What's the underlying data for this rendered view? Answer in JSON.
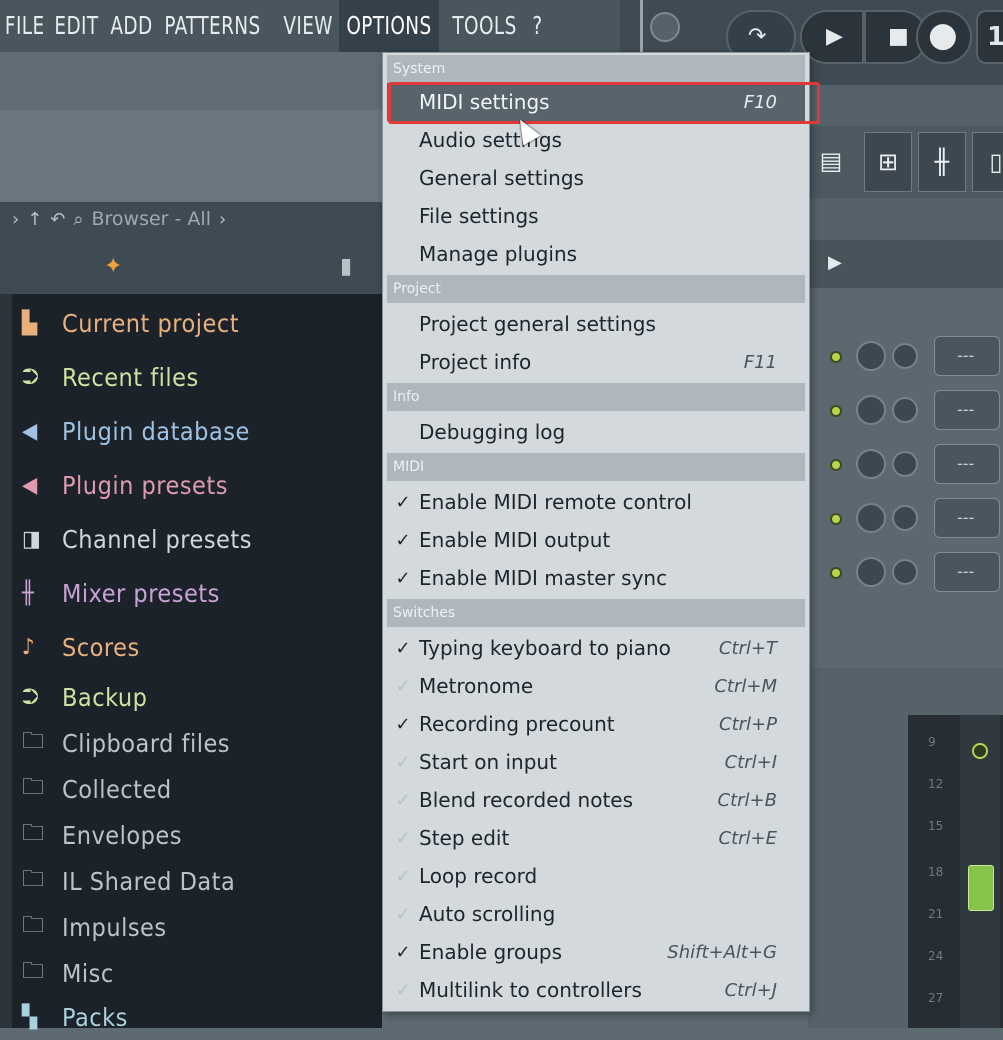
{
  "menubar": {
    "items": [
      "FILE",
      "EDIT",
      "ADD",
      "PATTERNS",
      "VIEW",
      "OPTIONS",
      "TOOLS",
      "?"
    ],
    "active": "OPTIONS"
  },
  "transport": {
    "counter_digit": "1"
  },
  "browser": {
    "header": "Browser - All",
    "items": [
      {
        "label": "Current project",
        "icon": "folder-doc-icon",
        "color": "#e8b07c"
      },
      {
        "label": "Recent files",
        "icon": "recent-files-icon",
        "color": "#cfe2a2"
      },
      {
        "label": "Plugin database",
        "icon": "plugin-database-icon",
        "color": "#9fc1e2"
      },
      {
        "label": "Plugin presets",
        "icon": "plugin-presets-icon",
        "color": "#e09ab0"
      },
      {
        "label": "Channel presets",
        "icon": "channel-presets-icon",
        "color": "#d0d7db"
      },
      {
        "label": "Mixer presets",
        "icon": "mixer-presets-icon",
        "color": "#c9a2d6"
      },
      {
        "label": "Scores",
        "icon": "note-icon",
        "color": "#e8b07c"
      },
      {
        "label": "Backup",
        "icon": "backup-icon",
        "color": "#cfe2a2"
      },
      {
        "label": "Clipboard files",
        "icon": "folder-icon",
        "color": "#b9c3c8"
      },
      {
        "label": "Collected",
        "icon": "folder-icon",
        "color": "#b9c3c8"
      },
      {
        "label": "Envelopes",
        "icon": "folder-icon",
        "color": "#b9c3c8"
      },
      {
        "label": "IL Shared Data",
        "icon": "shared-folder-icon",
        "color": "#b9c3c8"
      },
      {
        "label": "Impulses",
        "icon": "folder-icon",
        "color": "#b9c3c8"
      },
      {
        "label": "Misc",
        "icon": "folder-icon",
        "color": "#b9c3c8"
      },
      {
        "label": "Packs",
        "icon": "packs-icon",
        "color": "#aad0dd"
      }
    ]
  },
  "options_menu": {
    "sections": {
      "system": "System",
      "project": "Project",
      "info": "Info",
      "midi": "MIDI",
      "switches": "Switches"
    },
    "system_items": [
      {
        "label": "MIDI settings",
        "shortcut": "F10"
      },
      {
        "label": "Audio settings",
        "shortcut": ""
      },
      {
        "label": "General settings",
        "shortcut": ""
      },
      {
        "label": "File settings",
        "shortcut": ""
      },
      {
        "label": "Manage plugins",
        "shortcut": ""
      }
    ],
    "project_items": [
      {
        "label": "Project general settings",
        "shortcut": ""
      },
      {
        "label": "Project info",
        "shortcut": "F11"
      }
    ],
    "info_items": [
      {
        "label": "Debugging log",
        "shortcut": ""
      }
    ],
    "midi_items": [
      {
        "label": "Enable MIDI remote control",
        "checked": true
      },
      {
        "label": "Enable MIDI output",
        "checked": true
      },
      {
        "label": "Enable MIDI master sync",
        "checked": true
      }
    ],
    "switch_items": [
      {
        "label": "Typing keyboard to piano",
        "shortcut": "Ctrl+T",
        "checked": true
      },
      {
        "label": "Metronome",
        "shortcut": "Ctrl+M",
        "checked": false
      },
      {
        "label": "Recording precount",
        "shortcut": "Ctrl+P",
        "checked": true
      },
      {
        "label": "Start on input",
        "shortcut": "Ctrl+I",
        "checked": false
      },
      {
        "label": "Blend recorded notes",
        "shortcut": "Ctrl+B",
        "checked": false
      },
      {
        "label": "Step edit",
        "shortcut": "Ctrl+E",
        "checked": false
      },
      {
        "label": "Loop record",
        "shortcut": "",
        "checked": false
      },
      {
        "label": "Auto scrolling",
        "shortcut": "",
        "checked": false
      },
      {
        "label": "Enable groups",
        "shortcut": "Shift+Alt+G",
        "checked": true
      },
      {
        "label": "Multilink to controllers",
        "shortcut": "Ctrl+J",
        "checked": false
      }
    ],
    "check_glyph": "✓"
  },
  "channel_rack": {
    "button_label": "---"
  },
  "mixer": {
    "track_numbers": [
      "9",
      "12",
      "15",
      "18",
      "21",
      "24",
      "27"
    ]
  },
  "colors": {
    "menu_highlight": "#57646c",
    "annotation_box": "#e0393a",
    "led_green": "#b9d64b"
  }
}
